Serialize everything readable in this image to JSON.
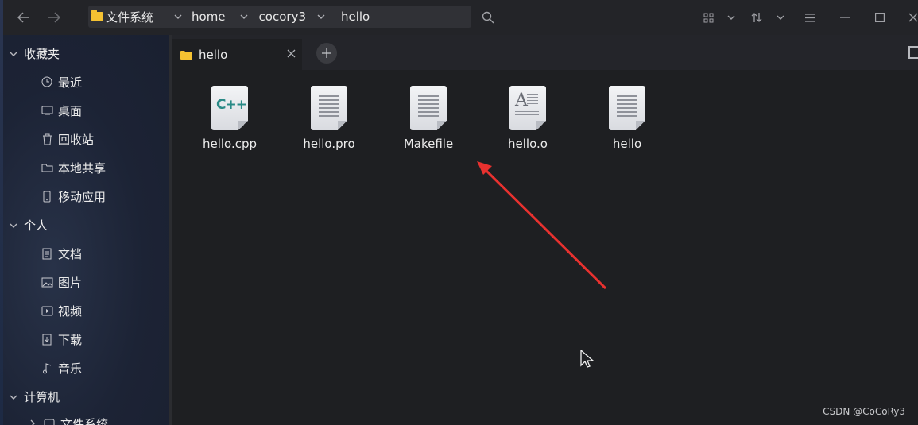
{
  "path": {
    "crumbs": [
      "文件系统",
      "home",
      "cocory3",
      "hello"
    ]
  },
  "sidebar": {
    "sections": [
      {
        "label": "收藏夹",
        "items": [
          {
            "label": "最近",
            "icon": "clock-icon"
          },
          {
            "label": "桌面",
            "icon": "desktop-icon"
          },
          {
            "label": "回收站",
            "icon": "trash-icon"
          },
          {
            "label": "本地共享",
            "icon": "folder-icon"
          },
          {
            "label": "移动应用",
            "icon": "phone-icon"
          }
        ]
      },
      {
        "label": "个人",
        "items": [
          {
            "label": "文档",
            "icon": "document-icon"
          },
          {
            "label": "图片",
            "icon": "image-icon"
          },
          {
            "label": "视频",
            "icon": "video-icon"
          },
          {
            "label": "下载",
            "icon": "download-icon"
          },
          {
            "label": "音乐",
            "icon": "music-icon"
          }
        ]
      },
      {
        "label": "计算机",
        "items": [
          {
            "label": "文件系统",
            "icon": "drive-icon"
          }
        ]
      }
    ]
  },
  "tab": {
    "label": "hello"
  },
  "files": [
    {
      "name": "hello.cpp",
      "icon": "cpp-file-icon"
    },
    {
      "name": "hello.pro",
      "icon": "text-file-icon"
    },
    {
      "name": "Makefile",
      "icon": "text-file-icon"
    },
    {
      "name": "hello.o",
      "icon": "object-file-icon"
    },
    {
      "name": "hello",
      "icon": "text-file-icon"
    }
  ],
  "watermark": "CSDN @CoCoRy3",
  "colors": {
    "accent_arrow": "#e8312f",
    "folder": "#f5c232",
    "background": "#1e1f22"
  }
}
